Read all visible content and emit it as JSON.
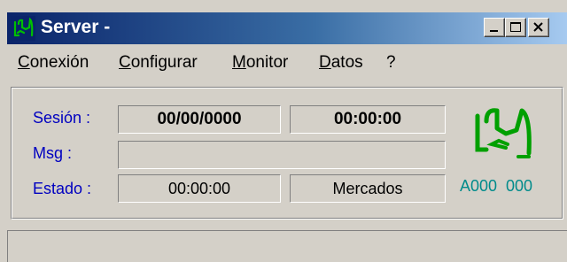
{
  "window": {
    "title": "Server -",
    "controls": {
      "minimize": "minimize",
      "maximize": "maximize",
      "close": "close"
    }
  },
  "menu": {
    "items": [
      {
        "underline": "C",
        "rest": "onexión"
      },
      {
        "underline": "C",
        "rest": "onfigurar"
      },
      {
        "underline": "M",
        "rest": "onitor"
      },
      {
        "underline": "D",
        "rest": "atos"
      },
      {
        "underline": "",
        "rest": "?"
      }
    ]
  },
  "panel": {
    "sesion_label": "Sesión :",
    "msg_label": "Msg :",
    "estado_label": "Estado :",
    "sesion_date": "00/00/0000",
    "sesion_time": "00:00:00",
    "msg_value": "",
    "estado_time": "00:00:00",
    "estado_value": "Mercados",
    "code": "A000  000"
  },
  "status": {
    "text": ""
  },
  "colors": {
    "label_blue": "#0000c0",
    "code_teal": "#008b8b",
    "logo_green": "#00a000",
    "title_dark": "#0a246a"
  },
  "icons": {
    "app": "server-app-icon",
    "logo": "server-logo-icon"
  }
}
